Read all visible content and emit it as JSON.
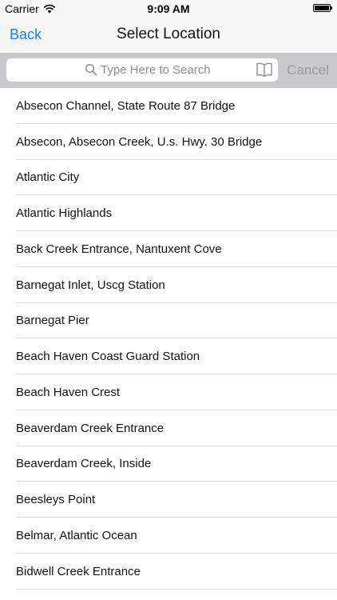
{
  "status_bar": {
    "carrier": "Carrier",
    "time": "9:09 AM",
    "battery_level": 1.0
  },
  "nav": {
    "back_label": "Back",
    "title": "Select Location"
  },
  "search": {
    "placeholder": "Type Here to Search",
    "value": "",
    "cancel_label": "Cancel"
  },
  "icons": {
    "search": "search-icon",
    "bookmark": "book-icon",
    "wifi": "wifi-icon",
    "battery": "battery-icon"
  },
  "colors": {
    "accent": "#1a7ff5",
    "search_bar_bg": "#c9c9ce",
    "separator": "#dcdce0"
  },
  "locations": [
    "Absecon Channel, State Route 87 Bridge",
    "Absecon, Absecon Creek, U.s. Hwy. 30 Bridge",
    "Atlantic City",
    "Atlantic Highlands",
    "Back Creek Entrance, Nantuxent Cove",
    "Barnegat Inlet, Uscg Station",
    "Barnegat Pier",
    "Beach Haven Coast Guard Station",
    "Beach Haven Crest",
    "Beaverdam Creek Entrance",
    "Beaverdam Creek, Inside",
    "Beesleys Point",
    "Belmar, Atlantic Ocean",
    "Bidwell Creek Entrance"
  ]
}
